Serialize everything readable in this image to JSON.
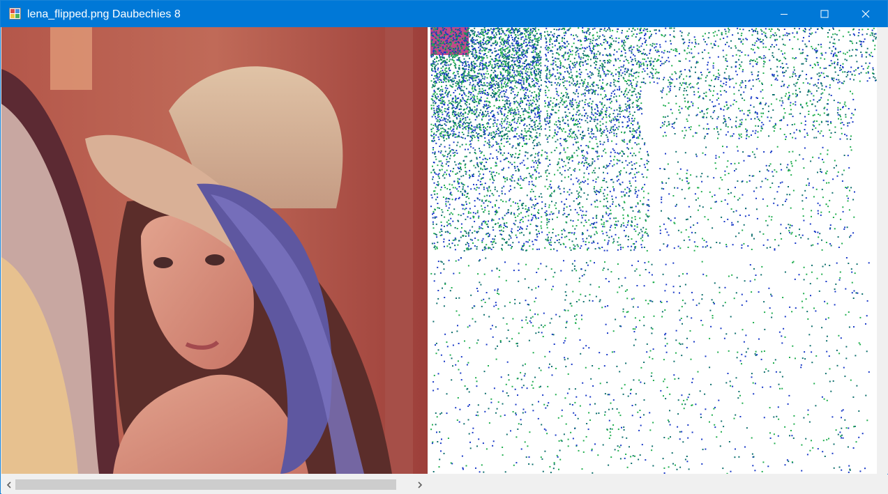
{
  "window": {
    "title": "lena_flipped.png Daubechies 8",
    "controls": {
      "minimize": "minimize-icon",
      "maximize": "maximize-icon",
      "close": "close-icon"
    },
    "app_icon": "app-icon"
  },
  "colors": {
    "titlebar": "#0078d7",
    "photo_skin": "#d79584",
    "photo_wall": "#a8463c",
    "feather": "#5e57a0",
    "hat": "#d8b79c",
    "wavelet_blue": "#1738c7",
    "wavelet_green": "#1fae4e",
    "wavelet_teal": "#0d6f6d"
  },
  "scrollbar": {
    "left_arrow": "chevron-left-icon",
    "right_arrow": "chevron-right-icon"
  }
}
